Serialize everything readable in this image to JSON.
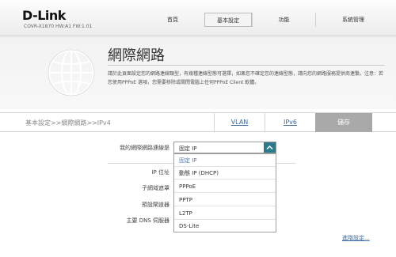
{
  "header": {
    "logo": "D-Link",
    "model": "COVR-X1870 HW:A1 FW:1.01",
    "nav": [
      "首頁",
      "基本設定",
      "功能",
      "系統管理"
    ],
    "active_nav_index": 1
  },
  "hero": {
    "title": "網際網路",
    "description": "請於此頁面設定您的網路連線類型，有幾種連線型態可選擇，如果您不確定您的連線型態，請向您的網路服務提供商連繫。注意：若您使用PPPoE 選項，您需要移除或關閉電腦上任何PPPoE Client 軟體。"
  },
  "tabbar": {
    "breadcrumb": "基本設定>>網際網路>>IPv4",
    "tabs": [
      "VLAN",
      "IPv6"
    ],
    "save_label": "儲存"
  },
  "form": {
    "connection_type_label": "我的網際網路連線是",
    "connection_type_value": "固定 IP",
    "ip_label": "IP 位址",
    "subnet_label": "子網域遮罩",
    "gateway_label": "預設閘道器",
    "dns_label": "主要 DNS 伺服器",
    "options": [
      "固定 IP",
      "動態 IP (DHCP)",
      "PPPoE",
      "PPTP",
      "L2TP",
      "DS-Lite"
    ],
    "selected_option_index": 0,
    "advanced_link": "進階設定..."
  },
  "colors": {
    "select_button": "#2c7b8c",
    "link": "#3a6aa0",
    "save_button": "#a9a9a9"
  }
}
